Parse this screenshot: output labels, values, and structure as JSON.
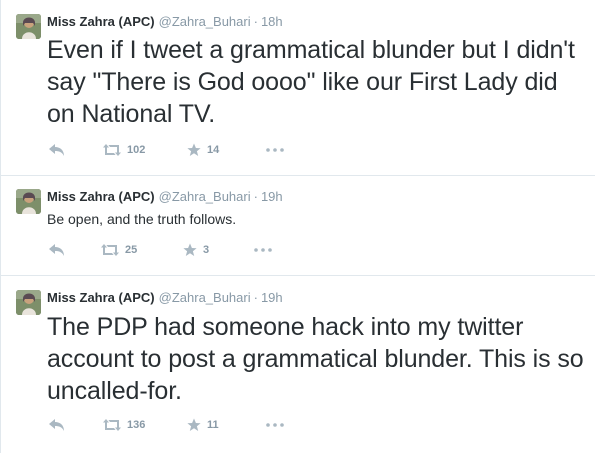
{
  "colors": {
    "text": "#292f33",
    "muted": "#8899a6",
    "icon": "#aab8c2",
    "divider": "#e1e8ed"
  },
  "tweets": [
    {
      "name": "Miss Zahra (APC)",
      "handle": "@Zahra_Buhari",
      "separator": "·",
      "time": "18h",
      "text": "Even if I tweet a grammatical blunder but I didn't say \"There is God oooo\" like our First Lady did on National TV.",
      "retweets": "102",
      "favorites": "14"
    },
    {
      "name": "Miss Zahra (APC)",
      "handle": "@Zahra_Buhari",
      "separator": "·",
      "time": "19h",
      "text": "Be open, and the truth follows.",
      "retweets": "25",
      "favorites": "3"
    },
    {
      "name": "Miss Zahra (APC)",
      "handle": "@Zahra_Buhari",
      "separator": "·",
      "time": "19h",
      "text": "The PDP had someone hack into my twitter account to post a grammatical blunder. This is so uncalled-for.",
      "retweets": "136",
      "favorites": "11"
    }
  ],
  "icons": {
    "avatar": "avatar-photo",
    "reply": "reply-icon",
    "retweet": "retweet-icon",
    "favorite": "star-icon",
    "more": "more-icon"
  }
}
